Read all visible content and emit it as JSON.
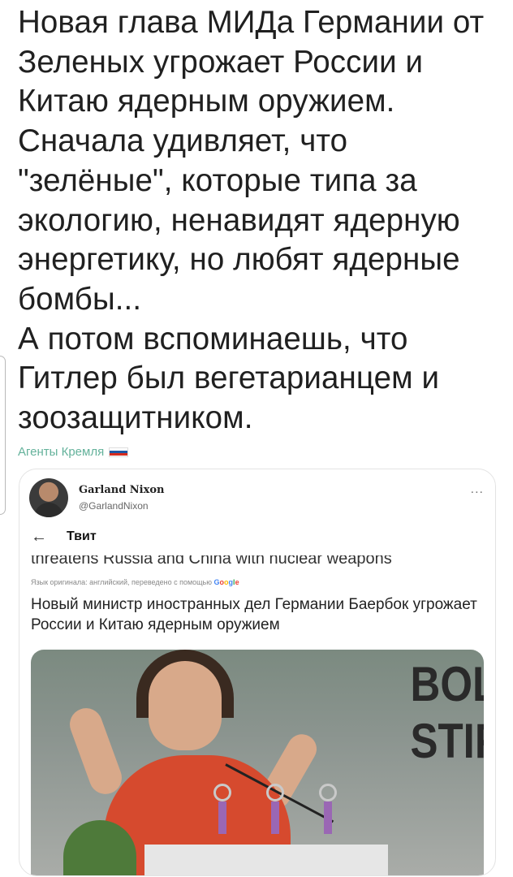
{
  "post": {
    "text": "Новая глава МИДа Германии от\nЗеленых угрожает России и\nКитаю ядерным оружием.\nСначала удивляет, что\n\"зелёные\", которые типа за\nэкологию, ненавидят ядерную\nэнергетику, но любят ядерные\nбомбы...\nА потом вспоминаешь, что\nГитлер был вегетарианцем и\nзоозащитником.",
    "channel": "Агенты Кремля",
    "flag_colors": [
      "#ffffff",
      "#1c57a5",
      "#d52b1e"
    ]
  },
  "card": {
    "author_name": "Garland Nixon",
    "author_handle": "@GarlandNixon",
    "more": "...",
    "nav_title": "Твит",
    "cut_line": "threatens Russia and China with nuclear weapons",
    "translated_note": "Язык оригинала: английский, переведено с помощью",
    "google": [
      "G",
      "o",
      "o",
      "g",
      "l",
      "e"
    ],
    "translation": "Новый министр иностранных дел Германии Баербок угрожает России и Китаю ядерным оружием",
    "photo_backdrop": "BOL\nSTIF"
  },
  "icons": {
    "back": "back-arrow-icon",
    "more": "more-icon"
  },
  "colors": {
    "channel": "#64b29b",
    "speaker_dress": "#d64a2e"
  }
}
